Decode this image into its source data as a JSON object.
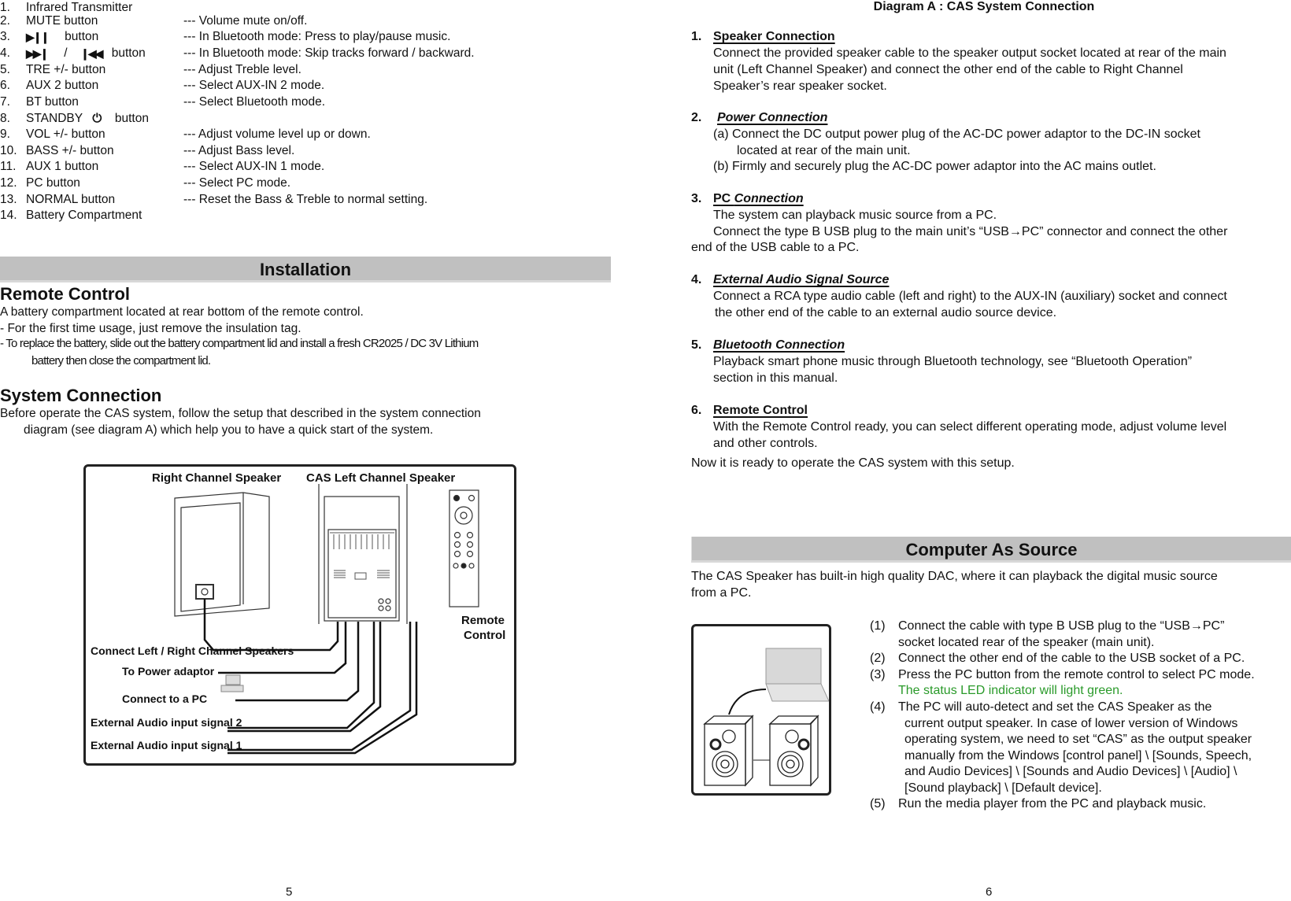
{
  "left_page": {
    "features": [
      {
        "num": "1.",
        "label": "Infrared Transmitter",
        "desc": ""
      },
      {
        "num": "2.",
        "label": "MUTE button",
        "desc": "--- Volume mute on/off."
      },
      {
        "num": "3.",
        "label": "button",
        "icon": "play-pause-icon",
        "desc": "--- In Bluetooth mode: Press to play/pause music."
      },
      {
        "num": "4.",
        "label": "button",
        "icon": "skip-forward-backward-icon",
        "desc": "--- In Bluetooth mode: Skip tracks forward / backward."
      },
      {
        "num": "5.",
        "label": "TRE +/- button",
        "desc": "--- Adjust Treble level."
      },
      {
        "num": "6.",
        "label": "AUX 2 button",
        "desc": "--- Select AUX-IN 2 mode."
      },
      {
        "num": "7.",
        "label": "BT button",
        "desc": "--- Select Bluetooth mode."
      },
      {
        "num": "8.",
        "label": "STANDBY",
        "label_suffix": "button",
        "icon": "power-icon",
        "desc": ""
      },
      {
        "num": "9.",
        "label": "VOL +/- button",
        "desc": "--- Adjust volume level up or down."
      },
      {
        "num": "10.",
        "label": "BASS +/- button",
        "desc": "--- Adjust Bass level."
      },
      {
        "num": "11.",
        "label": "AUX 1 button",
        "desc": "--- Select AUX-IN 1 mode."
      },
      {
        "num": "12.",
        "label": "PC button",
        "desc": "--- Select PC mode."
      },
      {
        "num": "13.",
        "label": "NORMAL button",
        "desc": "--- Reset the Bass & Treble to normal setting."
      },
      {
        "num": "14.",
        "label": "Battery Compartment",
        "desc": ""
      }
    ],
    "glyphs": {
      "slash": "/"
    },
    "installation_title": "Installation",
    "remote_control": {
      "heading": "Remote Control",
      "lines": [
        "A battery compartment located at rear bottom of the remote control.",
        "- For the first time usage, just remove the insulation tag.",
        "- To replace the battery, slide out the battery compartment lid and install a fresh CR2025 / DC 3V Lithium",
        "battery then close the compartment lid."
      ]
    },
    "system_connection": {
      "heading": "System Connection",
      "lines": [
        "Before operate the CAS system, follow the setup that described in the system connection",
        "diagram (see diagram A) which help you to have a quick start of the system."
      ]
    },
    "diagram_labels": {
      "right_speaker": "Right Channel Speaker",
      "left_speaker": "CAS Left Channel Speaker",
      "remote_line1": "Remote",
      "remote_line2": "Control",
      "connect_speakers": "Connect Left / Right Channel Speakers",
      "power": "To Power adaptor",
      "pc": "Connect to a PC",
      "ext2": "External Audio input signal 2",
      "ext1": "External Audio input signal 1"
    },
    "page_number": "5"
  },
  "right_page": {
    "title": "Diagram A : CAS System Connection",
    "items": [
      {
        "num": "1.",
        "label": "Speaker Connection",
        "lines": [
          "Connect the provided speaker cable to the speaker output socket located at rear of the main",
          "unit (Left Channel Speaker) and connect the other end of the cable to Right Channel",
          "Speaker’s rear speaker socket."
        ]
      },
      {
        "num": "2.",
        "label": "Power Connection",
        "lines": [
          "(a) Connect the DC output power plug of the AC-DC power adaptor to the DC-IN socket",
          "located at rear of the main unit.",
          "(b) Firmly and securely plug the AC-DC power adaptor into the AC mains outlet."
        ]
      },
      {
        "num": "3.",
        "label_plain": "PC ",
        "label": "Connection",
        "lines": [
          "The system can playback music source from a PC.",
          "Connect the type B USB plug to the main unit’s “USB→PC” connector and connect the other",
          "end of the USB cable to a PC."
        ]
      },
      {
        "num": "4.",
        "label": "External Audio Signal Source",
        "lines": [
          "Connect a RCA type audio cable (left and right) to the AUX-IN (auxiliary) socket and connect",
          "the other end of the cable to an external audio source device."
        ]
      },
      {
        "num": "5.",
        "label": "Bluetooth Connection",
        "lines": [
          "Playback smart phone music through Bluetooth technology, see “Bluetooth Operation”",
          "section in this manual."
        ]
      },
      {
        "num": "6.",
        "label": "Remote Control",
        "lines": [
          "With the Remote Control ready, you can select different operating mode, adjust volume level",
          "and other controls."
        ]
      }
    ],
    "ready_text": "Now it is ready to operate the CAS system with this setup.",
    "cas_title": "Computer As Source",
    "cas_intro": [
      "The CAS Speaker has built-in high quality DAC, where it can playback the digital music source",
      "from a PC."
    ],
    "cas_steps": [
      {
        "num": "(1)",
        "lines": [
          "Connect the cable with type B USB plug to the “USB→PC”",
          "socket located rear of the speaker (main unit)."
        ]
      },
      {
        "num": "(2)",
        "lines": [
          "Connect the other end of the cable to the USB socket of a PC."
        ]
      },
      {
        "num": "(3)",
        "lines": [
          "Press the PC button from the remote control to select PC mode."
        ],
        "note": "The status LED indicator will light green."
      },
      {
        "num": "(4)",
        "lines": [
          "The PC will auto-detect and set the CAS Speaker as the",
          "current output speaker. In case of lower version of Windows",
          "operating system, we need to set “CAS” as the output speaker",
          "manually from the Windows [control panel] \\ [Sounds, Speech,",
          "and Audio Devices] \\ [Sounds and Audio Devices] \\ [Audio] \\",
          "[Sound playback] \\ [Default device]."
        ]
      },
      {
        "num": "(5)",
        "lines": [
          "Run the media player from the PC and playback music."
        ]
      }
    ],
    "colors": {
      "note_green": "#2a9a2a",
      "section_bar": "#c0c0c0"
    },
    "page_number": "6"
  }
}
